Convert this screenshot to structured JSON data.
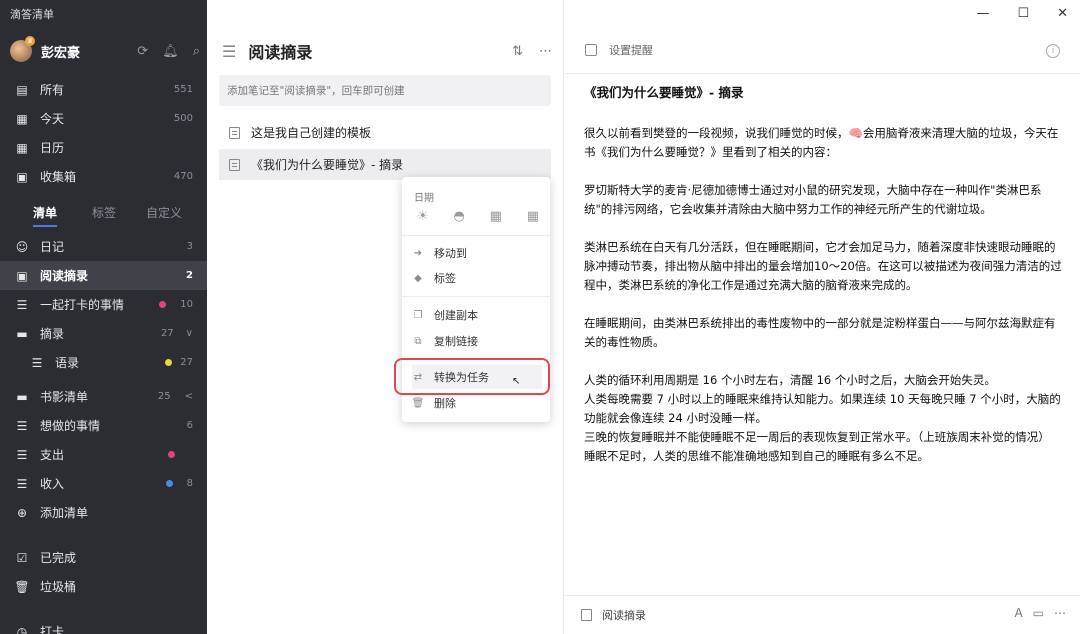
{
  "app": {
    "title": "滴答清单"
  },
  "user": {
    "name": "彭宏豪"
  },
  "sidebar": {
    "smart_lists": [
      {
        "label": "所有",
        "count": "551",
        "icon": "inbox-all-icon"
      },
      {
        "label": "今天",
        "count": "500",
        "icon": "calendar-day-icon"
      },
      {
        "label": "日历",
        "count": "",
        "icon": "calendar-icon"
      },
      {
        "label": "收集箱",
        "count": "470",
        "icon": "inbox-icon"
      }
    ],
    "tabs": [
      "清单",
      "标签",
      "自定义"
    ],
    "lists": [
      {
        "label": "日记",
        "count": "3"
      },
      {
        "label": "阅读摘录",
        "count": "2"
      },
      {
        "label": "一起打卡的事情",
        "count": "10",
        "dot": "#e5427c"
      },
      {
        "label": "摘录",
        "count": "27",
        "chevron": "∨"
      },
      {
        "label": "语录",
        "count": "27",
        "dot": "#e7d83c"
      },
      {
        "label": "书影清单",
        "count": "25",
        "chevron": "<"
      },
      {
        "label": "想做的事情",
        "count": "6"
      },
      {
        "label": "支出",
        "count": "",
        "dot": "#e5427c"
      },
      {
        "label": "收入",
        "count": "8",
        "dot": "#4a8bea"
      },
      {
        "label": "添加清单",
        "count": ""
      }
    ],
    "bottom": [
      {
        "label": "已完成"
      },
      {
        "label": "垃圾桶"
      },
      {
        "label": "打卡"
      }
    ]
  },
  "middle": {
    "title": "阅读摘录",
    "add_placeholder": "添加笔记至\"阅读摘录\"，回车即可创建",
    "notes": [
      {
        "title": "这是我自己创建的模板"
      },
      {
        "title": "《我们为什么要睡觉》- 摘录"
      }
    ]
  },
  "context_menu": {
    "date_label": "日期",
    "items": [
      "移动到",
      "标签",
      "创建副本",
      "复制链接",
      "转换为任务",
      "删除"
    ]
  },
  "detail": {
    "reminder": "设置提醒",
    "title": "《我们为什么要睡觉》- 摘录",
    "paragraphs": [
      "很久以前看到樊登的一段视频，说我们睡觉的时候，🧠会用脑脊液来清理大脑的垃圾，今天在书《我们为什么要睡觉？》里看到了相关的内容：",
      "罗切斯特大学的麦肯·尼德加德博士通过对小鼠的研究发现，大脑中存在一种叫作\"类淋巴系统\"的排污网络，它会收集并清除由大脑中努力工作的神经元所产生的代谢垃圾。",
      "类淋巴系统在白天有几分活跃，但在睡眠期间，它才会加足马力，随着深度非快速眼动睡眠的脉冲搏动节奏，排出物从脑中排出的量会增加10～20倍。在这可以被描述为夜间强力清洁的过程中，类淋巴系统的净化工作是通过充满大脑的脑脊液来完成的。",
      "在睡眠期间，由类淋巴系统排出的毒性废物中的一部分就是淀粉样蛋白——与阿尔兹海默症有关的毒性物质。",
      "人类的循环利用周期是 16 个小时左右，清醒 16 个小时之后，大脑会开始失灵。\n人类每晚需要 7 小时以上的睡眠来维持认知能力。如果连续 10 天每晚只睡 7 个小时，大脑的功能就会像连续 24 小时没睡一样。\n三晚的恢复睡眠并不能使睡眠不足一周后的表现恢复到正常水平。（上班族周末补觉的情况）\n睡眠不足时，人类的思维不能准确地感知到自己的睡眠有多么不足。"
    ],
    "footer_list": "阅读摘录"
  },
  "colors": {
    "sidebar_bg": "#2b2d33",
    "accent": "#4b7bec",
    "highlight_box": "#e2474b"
  }
}
